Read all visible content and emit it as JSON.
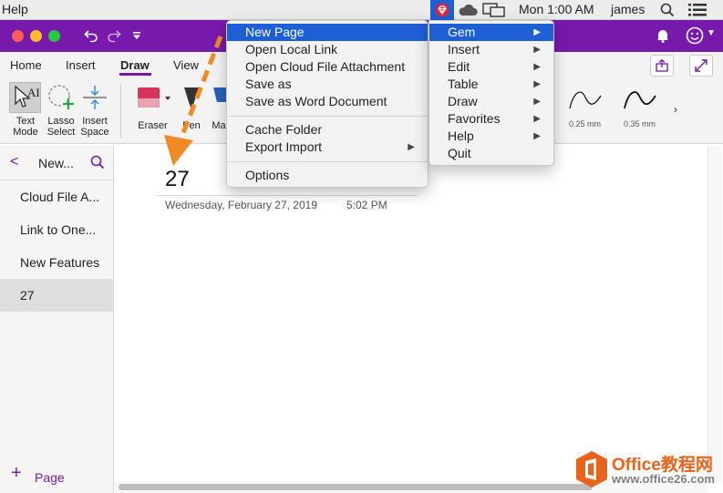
{
  "menubar": {
    "app_menu": "Help",
    "clock": "Mon 1:00 AM",
    "user": "james",
    "icons": [
      "gem-tray-icon",
      "onedrive-cloud-icon",
      "display-icon",
      "spotlight-search-icon",
      "notification-list-icon"
    ]
  },
  "ribbon": {
    "tabs": [
      "Home",
      "Insert",
      "Draw",
      "View"
    ],
    "active_tab": "Draw",
    "tools": {
      "text_mode": "Text\nMode",
      "text_mode_l1": "Text",
      "text_mode_l2": "Mode",
      "lasso_l1": "Lasso",
      "lasso_l2": "Select",
      "insert_l1": "Insert",
      "insert_l2": "Space",
      "eraser": "Eraser",
      "pen": "Pen",
      "marker": "Ma"
    },
    "pen_sizes": [
      "0.25 mm",
      "0.35 mm"
    ]
  },
  "sidebar": {
    "section_title": "New...",
    "pages": [
      "Cloud File A...",
      "Link to One...",
      "New Features",
      "27"
    ],
    "selected_page": "27",
    "add_page_label": "Page"
  },
  "page": {
    "heading": "27",
    "date": "Wednesday, February 27, 2019",
    "time": "5:02 PM"
  },
  "gem_menu": {
    "items": [
      "New Page",
      "Open Local Link",
      "Open Cloud File Attachment",
      "Save as",
      "Save as Word Document",
      "Cache Folder",
      "Export Import",
      "Options"
    ],
    "highlighted": "New Page"
  },
  "gem_submenu": {
    "items": [
      "Gem",
      "Insert",
      "Edit",
      "Table",
      "Draw",
      "Favorites",
      "Help",
      "Quit"
    ],
    "highlighted": "Gem"
  },
  "colors": {
    "onenote_purple": "#7719aa",
    "menu_highlight": "#1f5fd6",
    "annotation_arrow": "#f08a24",
    "watermark_orange": "#e8631b"
  },
  "watermark": {
    "title": "Office教程网",
    "url": "www.office26.com"
  }
}
